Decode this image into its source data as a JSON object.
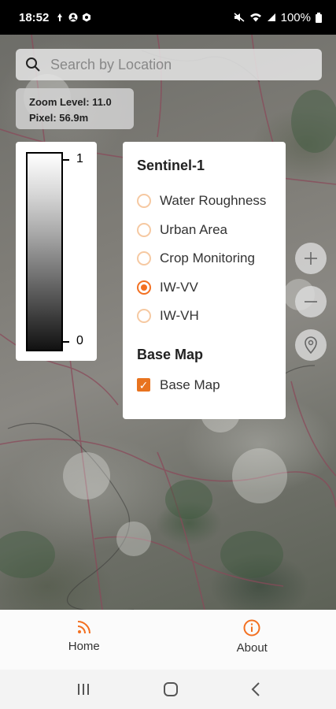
{
  "status_bar": {
    "time": "18:52",
    "battery": "100%"
  },
  "search": {
    "placeholder": "Search by Location"
  },
  "map_info": {
    "zoom_line": "Zoom Level: 11.0",
    "pixel_line": "Pixel: 56.9m"
  },
  "legend": {
    "max_label": "1",
    "min_label": "0"
  },
  "layer_panel": {
    "sentinel_heading": "Sentinel-1",
    "options": [
      {
        "label": "Water Roughness",
        "selected": false
      },
      {
        "label": "Urban Area",
        "selected": false
      },
      {
        "label": "Crop Monitoring",
        "selected": false
      },
      {
        "label": "IW-VV",
        "selected": true
      },
      {
        "label": "IW-VH",
        "selected": false
      }
    ],
    "base_heading": "Base Map",
    "base_checkbox_label": "Base Map",
    "base_checked": true
  },
  "map_controls": {
    "zoom_in_icon": "plus-icon",
    "zoom_out_icon": "minus-icon",
    "locate_icon": "location-pin-icon"
  },
  "bottom_nav": {
    "home_label": "Home",
    "about_label": "About",
    "accent": "#f37021"
  }
}
